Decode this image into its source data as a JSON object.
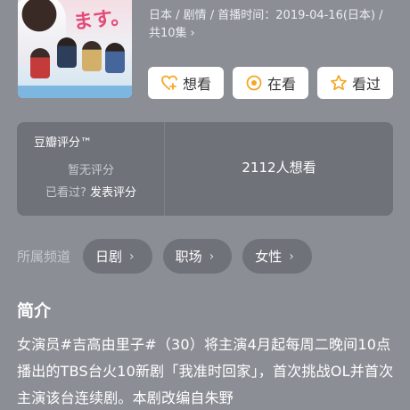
{
  "meta": {
    "line1": "日本 / 剧情 / 首播时间：2019-04-16(日本) /",
    "line2": "共10集"
  },
  "actions": [
    {
      "label": "想看",
      "icon": "want-icon"
    },
    {
      "label": "在看",
      "icon": "watching-icon"
    },
    {
      "label": "看过",
      "icon": "star-icon"
    }
  ],
  "rating": {
    "brand": "豆瓣评分™",
    "no_score": "暂无评分",
    "seen_question": "已看过?",
    "rate_link": "发表评分",
    "want_count": "2112人想看"
  },
  "channels": {
    "label": "所属频道",
    "tags": [
      "日剧",
      "职场",
      "女性"
    ]
  },
  "intro": {
    "title": "简介",
    "body": "女演员#吉高由里子#（30）将主演4月起每周二晚间10点播出的TBS台火10新剧「我准时回家」，首次挑战OL并首次主演该台连续剧。本剧改编自朱野"
  },
  "colors": {
    "background": "#8c8e96",
    "card": "#70727a",
    "accent_orange": "#f5a623"
  }
}
